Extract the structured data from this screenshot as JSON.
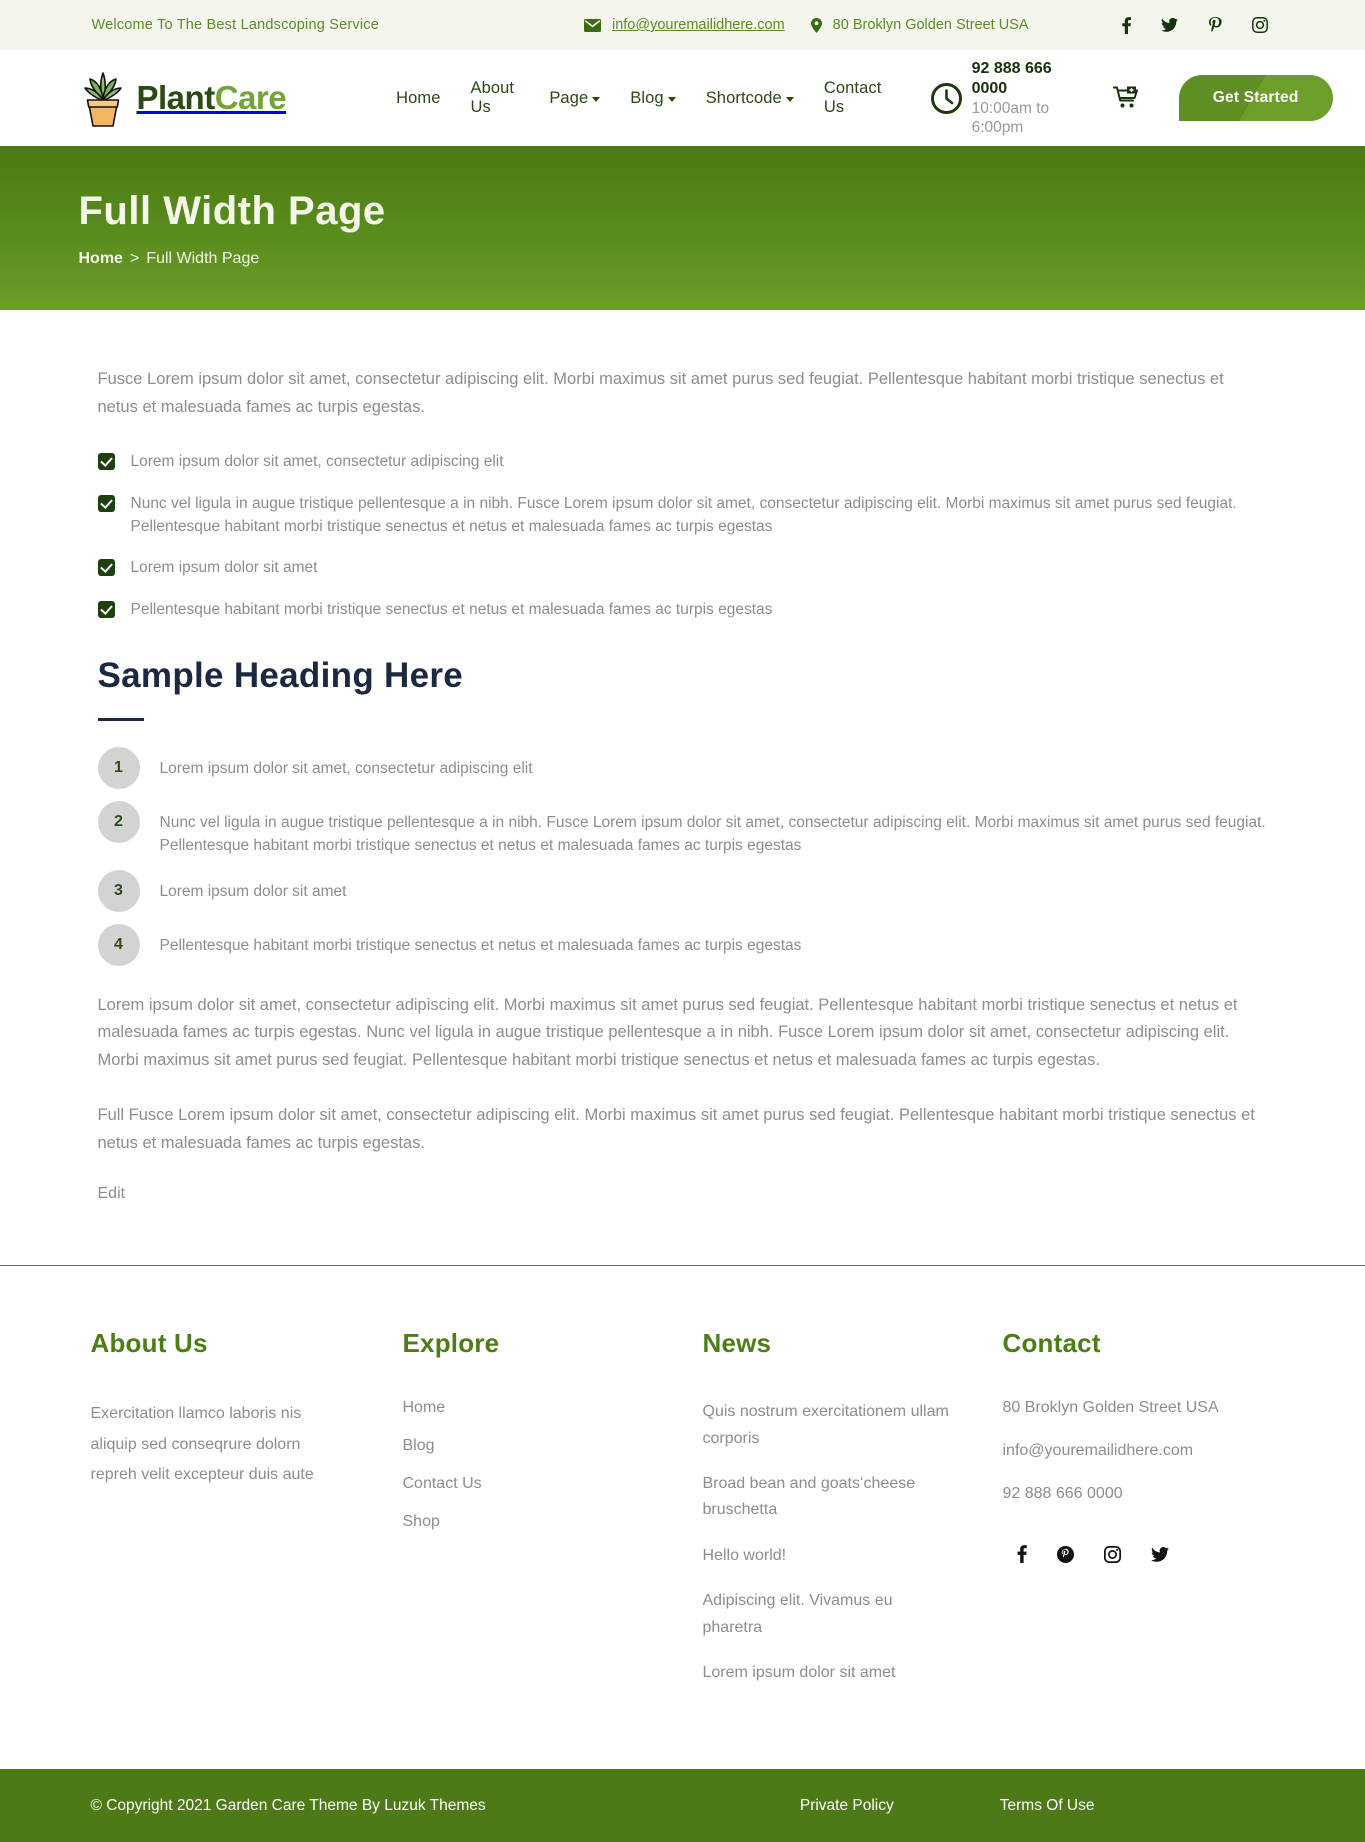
{
  "topbar": {
    "welcome": "Welcome To The Best Landscoping Service",
    "email": "info@youremailidhere.com",
    "address": "80 Broklyn Golden Street USA",
    "social": [
      "facebook-icon",
      "twitter-icon",
      "pinterest-icon",
      "instagram-icon"
    ]
  },
  "header": {
    "logo_part1": "Plant",
    "logo_part2": "Care",
    "nav": [
      {
        "label": "Home",
        "dropdown": false
      },
      {
        "label": "About Us",
        "dropdown": false
      },
      {
        "label": "Page",
        "dropdown": true
      },
      {
        "label": "Blog",
        "dropdown": true
      },
      {
        "label": "Shortcode",
        "dropdown": true
      },
      {
        "label": "Contact Us",
        "dropdown": false
      }
    ],
    "phone": "92 888 666 0000",
    "hours": "10:00am to 6:00pm",
    "cta_label": "Get Started"
  },
  "banner": {
    "title": "Full Width Page",
    "crumb_home": "Home",
    "crumb_sep": ">",
    "crumb_current": "Full Width Page"
  },
  "main": {
    "lead": "Fusce Lorem ipsum dolor sit amet, consectetur adipiscing elit. Morbi maximus sit amet purus sed feugiat. Pellentesque habitant morbi tristique senectus et netus et malesuada fames ac turpis egestas.",
    "checklist": [
      "Lorem ipsum dolor sit amet, consectetur adipiscing elit",
      "Nunc vel ligula in augue tristique pellentesque a in nibh. Fusce Lorem ipsum dolor sit amet, consectetur adipiscing elit. Morbi maximus sit amet purus sed feugiat. Pellentesque habitant morbi tristique senectus et netus et malesuada fames ac turpis egestas",
      "Lorem ipsum dolor sit amet",
      "Pellentesque habitant morbi tristique senectus et netus et malesuada fames ac turpis egestas"
    ],
    "heading": "Sample Heading Here",
    "numbered": [
      {
        "num": "1",
        "text": "Lorem ipsum dolor sit amet, consectetur adipiscing elit"
      },
      {
        "num": "2",
        "text": "Nunc vel ligula in augue tristique pellentesque a in nibh. Fusce Lorem ipsum dolor sit amet, consectetur adipiscing elit. Morbi maximus sit amet purus sed feugiat. Pellentesque habitant morbi tristique senectus et netus et malesuada fames ac turpis egestas"
      },
      {
        "num": "3",
        "text": "Lorem ipsum dolor sit amet"
      },
      {
        "num": "4",
        "text": "Pellentesque habitant morbi tristique senectus et netus et malesuada fames ac turpis egestas"
      }
    ],
    "para1": "Lorem ipsum dolor sit amet, consectetur adipiscing elit. Morbi maximus sit amet purus sed feugiat. Pellentesque habitant morbi tristique senectus et netus et malesuada fames ac turpis egestas. Nunc vel ligula in augue tristique pellentesque a in nibh. Fusce Lorem ipsum dolor sit amet, consectetur adipiscing elit. Morbi maximus sit amet purus sed feugiat. Pellentesque habitant morbi tristique senectus et netus et malesuada fames ac turpis egestas.",
    "para2": "Full Fusce Lorem ipsum dolor sit amet, consectetur adipiscing elit. Morbi maximus sit amet purus sed feugiat. Pellentesque habitant morbi tristique senectus et netus et malesuada fames ac turpis egestas.",
    "edit": "Edit"
  },
  "footer": {
    "about": {
      "heading": "About Us",
      "text": "Exercitation llamco laboris nis aliquip sed conseqrure dolorn repreh velit excepteur duis aute"
    },
    "explore": {
      "heading": "Explore",
      "links": [
        "Home",
        "Blog",
        "Contact Us",
        "Shop"
      ]
    },
    "news": {
      "heading": "News",
      "items": [
        "Quis nostrum exercitationem ullam corporis",
        "Broad bean and goatsʻcheese bruschetta",
        "Hello world!",
        "Adipiscing elit. Vivamus eu pharetra",
        "Lorem ipsum dolor sit amet"
      ]
    },
    "contact": {
      "heading": "Contact",
      "address": "80 Broklyn Golden Street USA",
      "email": "info@youremailidhere.com",
      "phone": "92 888 666 0000",
      "social": [
        "facebook-icon",
        "pinterest-icon",
        "instagram-icon",
        "twitter-icon"
      ]
    }
  },
  "copyright": {
    "text": "© Copyright 2021 Garden Care Theme By Luzuk Themes",
    "links": [
      "Private Policy",
      "Terms Of Use"
    ]
  },
  "colors": {
    "brand_green": "#5b8c2a",
    "dark_green": "#2c4a14",
    "banner_green": "#5a8c1e",
    "footer_bar": "#4d7a16",
    "heading_navy": "#1c2740",
    "body_text": "#8d8d8d"
  }
}
